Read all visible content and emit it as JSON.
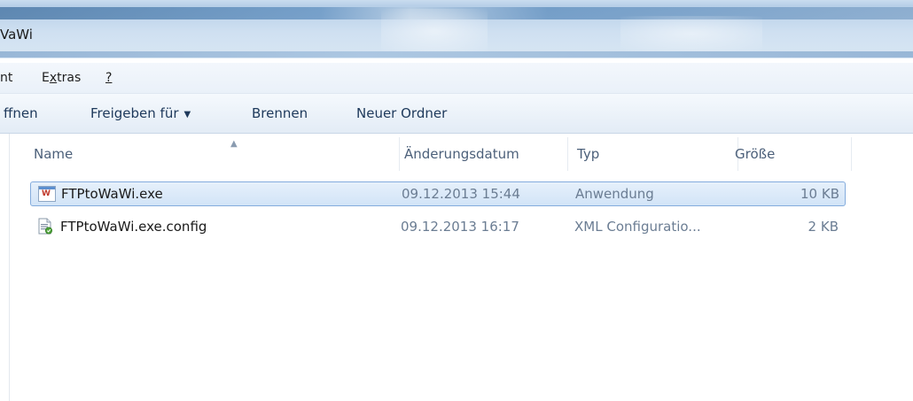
{
  "window": {
    "title": "VaWi"
  },
  "menu": {
    "items": [
      {
        "id": "ansicht",
        "text": "nt"
      },
      {
        "id": "extras",
        "prefix": "E",
        "underline": "x",
        "suffix": "tras"
      },
      {
        "id": "help",
        "text": "?"
      }
    ]
  },
  "commandbar": {
    "open": "ffnen",
    "share": "Freigeben für",
    "burn": "Brennen",
    "new_folder": "Neuer Ordner"
  },
  "columns": {
    "name": "Name",
    "date": "Änderungsdatum",
    "type": "Typ",
    "size": "Größe"
  },
  "files": [
    {
      "name": "FTPtoWaWi.exe",
      "date": "09.12.2013 15:44",
      "type": "Anwendung",
      "size": "10 KB",
      "icon": "exe-icon",
      "selected": true
    },
    {
      "name": "FTPtoWaWi.exe.config",
      "date": "09.12.2013 16:17",
      "type": "XML Configuratio...",
      "size": "2 KB",
      "icon": "config-file-icon",
      "selected": false
    }
  ],
  "colors": {
    "selection_border": "#84acdd",
    "selection_fill": "#d2e4f7",
    "header_text": "#4c607a",
    "command_text": "#1e395b"
  }
}
